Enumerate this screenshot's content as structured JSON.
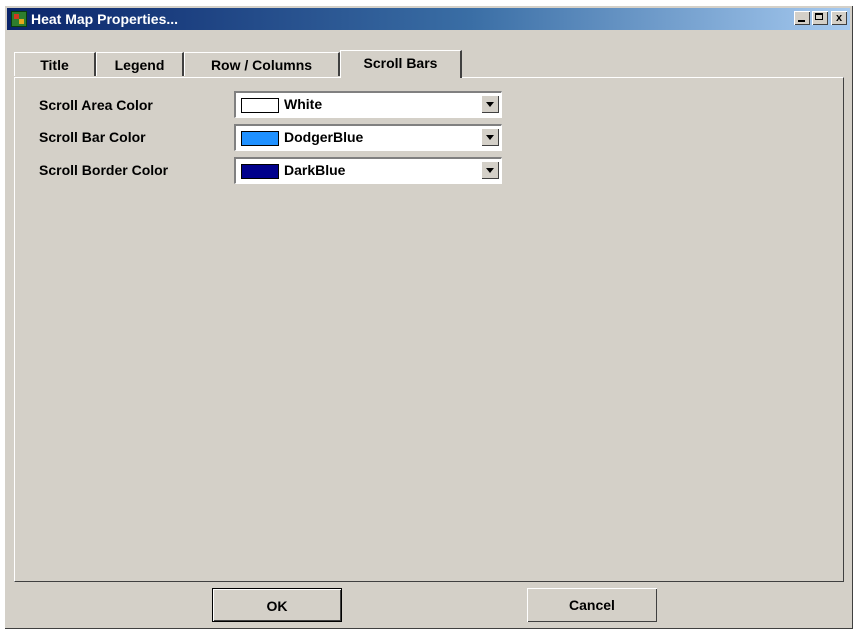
{
  "window": {
    "title": "Heat Map Properties...",
    "controls": {
      "minimize": "_",
      "maximize": "□",
      "close": "x"
    }
  },
  "tabs": [
    {
      "label": "Title",
      "active": false
    },
    {
      "label": "Legend",
      "active": false
    },
    {
      "label": "Row / Columns",
      "active": false
    },
    {
      "label": "Scroll Bars",
      "active": true
    }
  ],
  "fields": [
    {
      "label": "Scroll Area Color",
      "value": "White",
      "swatch": "#ffffff"
    },
    {
      "label": "Scroll Bar Color",
      "value": "DodgerBlue",
      "swatch": "#1e90ff"
    },
    {
      "label": "Scroll Border Color",
      "value": "DarkBlue",
      "swatch": "#00008b"
    }
  ],
  "buttons": {
    "ok": "OK",
    "cancel": "Cancel"
  }
}
